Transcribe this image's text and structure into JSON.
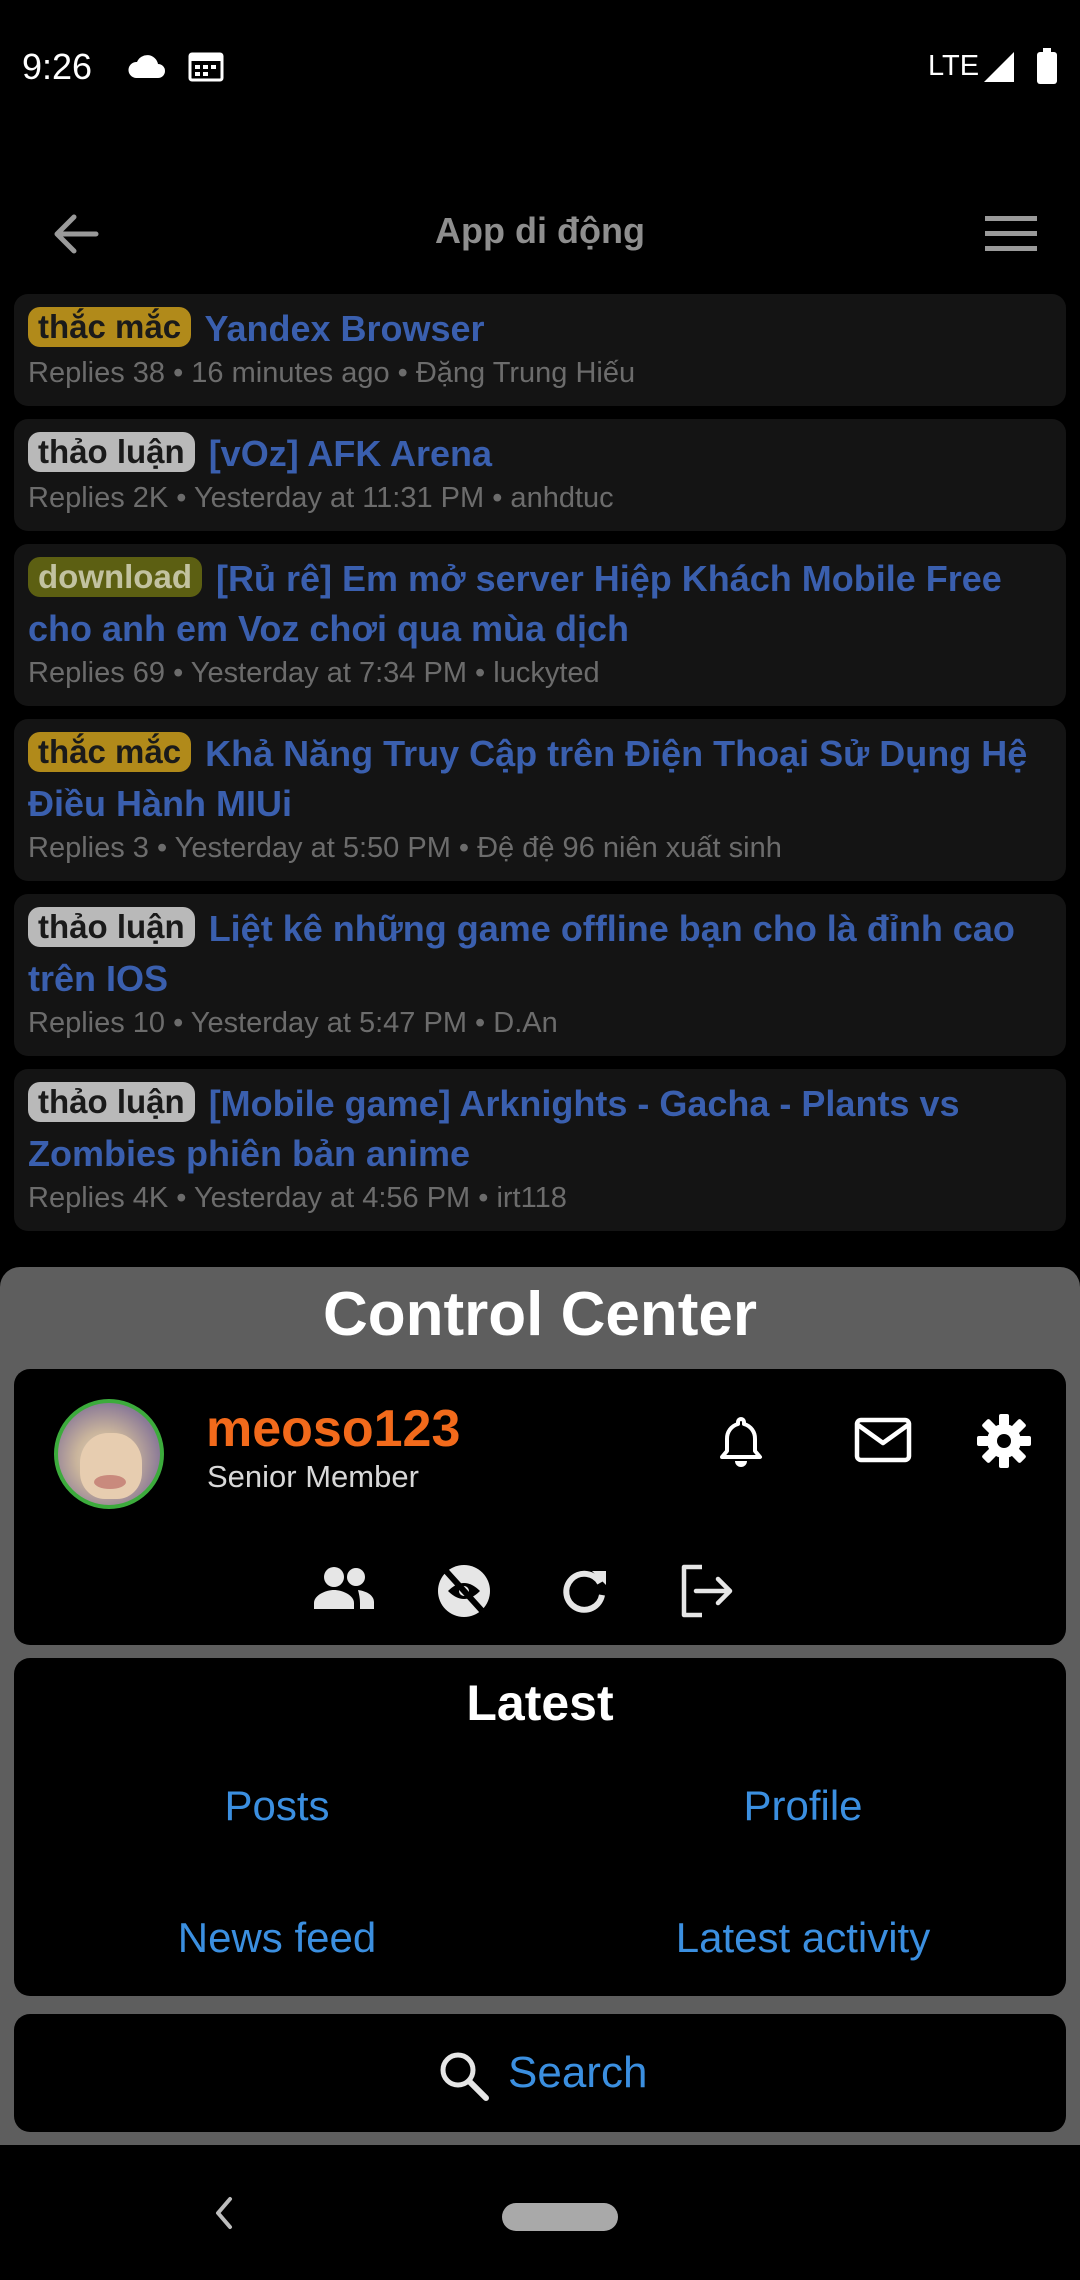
{
  "status_bar": {
    "time": "9:26",
    "network": "LTE"
  },
  "app_bar": {
    "title": "App di động"
  },
  "threads": [
    {
      "prefix": "thắc mắc",
      "prefix_kind": "question",
      "title": "Yandex Browser",
      "meta": "Replies 38 • 16 minutes ago • Đặng Trung Hiếu"
    },
    {
      "prefix": "thảo luận",
      "prefix_kind": "discuss",
      "title": "[vOz] AFK Arena",
      "meta": "Replies 2K • Yesterday at 11:31 PM • anhdtuc"
    },
    {
      "prefix": "download",
      "prefix_kind": "download",
      "title": "[Rủ rê] Em mở server Hiệp Khách Mobile Free cho anh em Voz chơi qua mùa dịch",
      "meta": "Replies 69 • Yesterday at 7:34 PM • luckyted"
    },
    {
      "prefix": "thắc mắc",
      "prefix_kind": "question",
      "title": "Khả Năng Truy Cập trên Điện Thoại Sử Dụng Hệ Điều Hành MIUi",
      "meta": "Replies 3 • Yesterday at 5:50 PM • Đệ đệ 96 niên xuất sinh"
    },
    {
      "prefix": "thảo luận",
      "prefix_kind": "discuss",
      "title": "Liệt kê những game offline bạn cho là đỉnh cao trên IOS",
      "meta": "Replies 10 • Yesterday at 5:47 PM • D.An"
    },
    {
      "prefix": "thảo luận",
      "prefix_kind": "discuss",
      "title": "[Mobile game] Arknights - Gacha - Plants vs Zombies phiên bản anime",
      "meta": "Replies 4K • Yesterday at 4:56 PM • irt118"
    }
  ],
  "control_center": {
    "title": "Control Center",
    "user": {
      "username": "meoso123",
      "user_title": "Senior Member"
    },
    "latest": {
      "title": "Latest",
      "links": [
        "Posts",
        "Profile",
        "News feed",
        "Latest activity"
      ]
    },
    "search_label": "Search"
  },
  "colors": {
    "background": "#000000",
    "thread_card": "#141414",
    "thread_title": "#3a5fae",
    "username": "#f26a1b",
    "link": "#3b8fe0",
    "control_center_bg": "#5e5e5e",
    "avatar_ring": "#3cab3c"
  }
}
